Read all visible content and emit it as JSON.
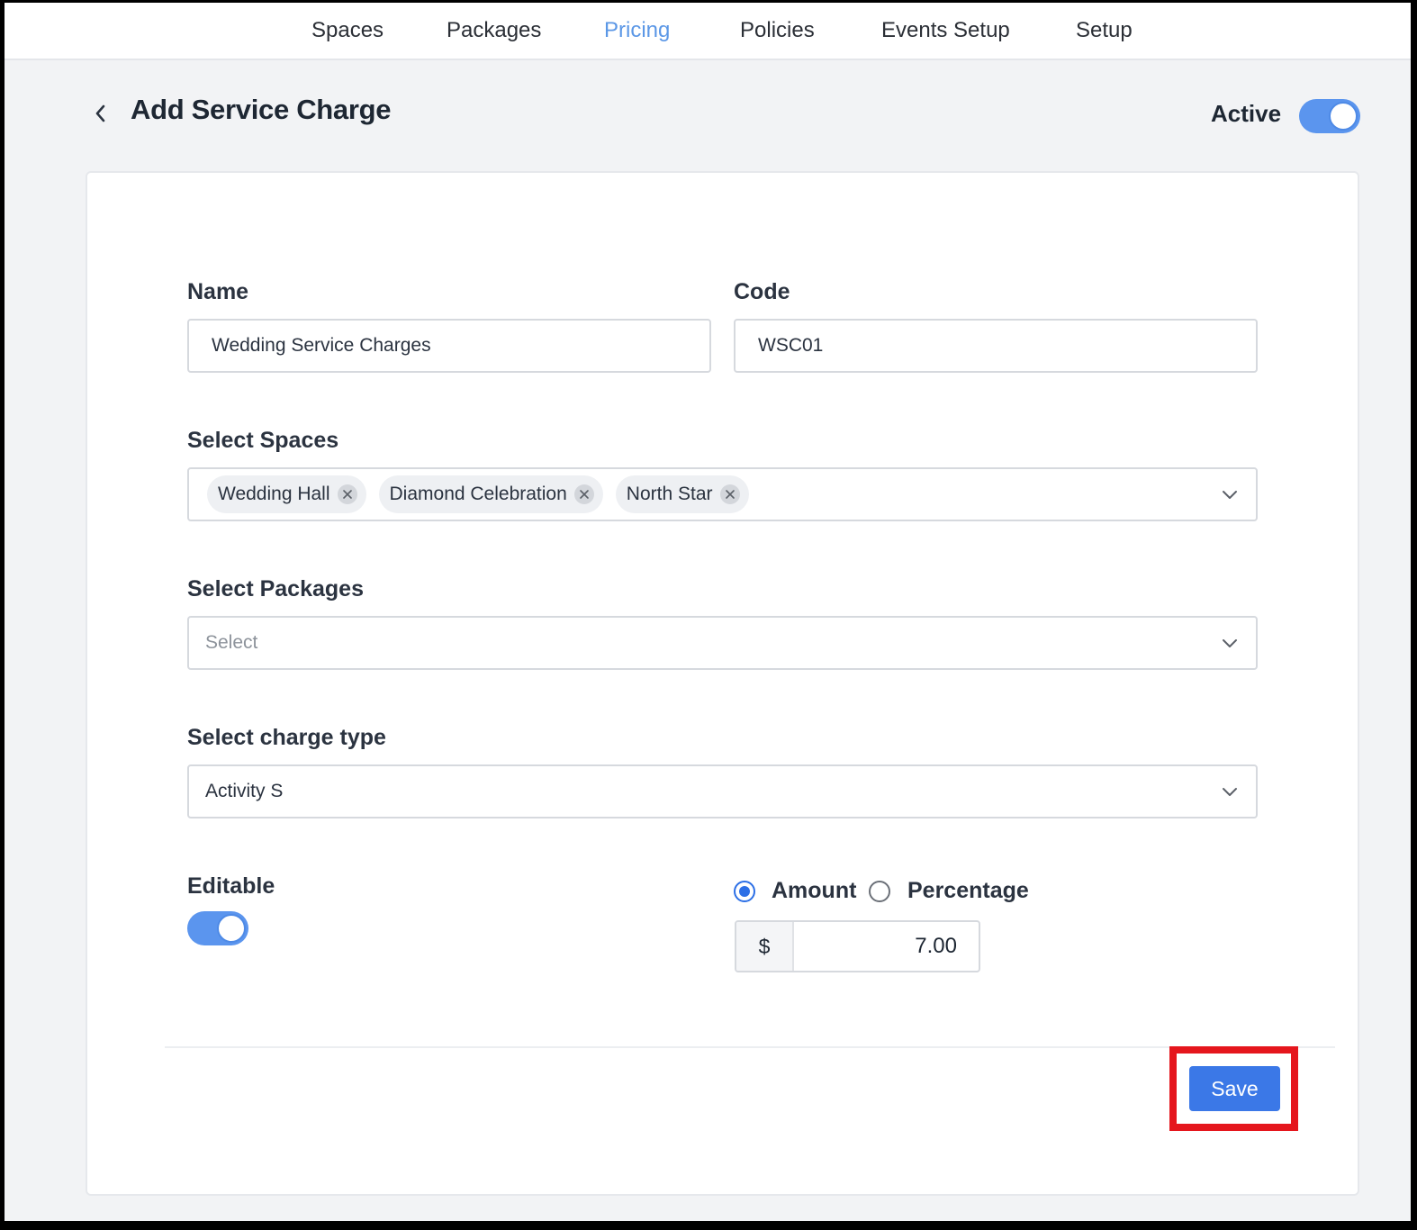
{
  "nav": {
    "items": [
      {
        "label": "Spaces",
        "active": false
      },
      {
        "label": "Packages",
        "active": false
      },
      {
        "label": "Pricing",
        "active": true
      },
      {
        "label": "Policies",
        "active": false
      },
      {
        "label": "Events Setup",
        "active": false
      },
      {
        "label": "Setup",
        "active": false
      }
    ],
    "active_color": "#5b97e6"
  },
  "header": {
    "back_icon": "chevron-left-icon",
    "title": "Add Service Charge",
    "active_label": "Active",
    "active_on": true
  },
  "form": {
    "name": {
      "label": "Name",
      "value": "Wedding Service Charges"
    },
    "code": {
      "label": "Code",
      "value": "WSC01"
    },
    "spaces": {
      "label": "Select Spaces",
      "selected": [
        "Wedding Hall",
        "Diamond Celebration",
        "North Star"
      ]
    },
    "packages": {
      "label": "Select Packages",
      "placeholder": "Select"
    },
    "charge_type": {
      "label": "Select charge type",
      "value": "Activity S"
    },
    "editable": {
      "label": "Editable",
      "on": true
    },
    "mode": {
      "options": [
        {
          "label": "Amount",
          "selected": true
        },
        {
          "label": "Percentage",
          "selected": false
        }
      ]
    },
    "amount": {
      "prefix": "$",
      "value": "7.00"
    }
  },
  "footer": {
    "save_label": "Save",
    "accent_color": "#3b78e7",
    "highlight_color": "#e5161d"
  }
}
